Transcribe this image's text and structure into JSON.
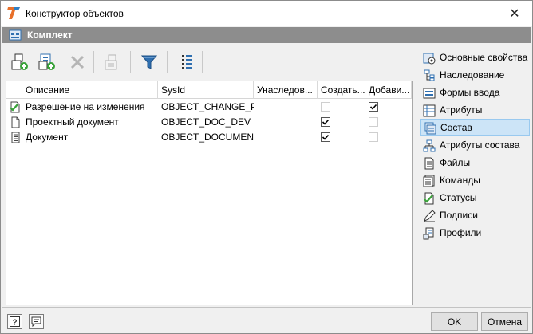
{
  "window": {
    "title": "Конструктор объектов",
    "app_icon": "app-logo-icon",
    "close_glyph": "✕"
  },
  "section": {
    "title": "Комплект",
    "icon": "kit-icon"
  },
  "toolbar": {
    "buttons": [
      {
        "name": "add-object-icon",
        "enabled": true
      },
      {
        "name": "add-object-from-set-icon",
        "enabled": true
      },
      {
        "name": "delete-icon",
        "enabled": false
      },
      {
        "name": "copy-object-icon",
        "enabled": false
      },
      {
        "name": "filter-icon",
        "enabled": true
      },
      {
        "name": "list-settings-icon",
        "enabled": true
      }
    ]
  },
  "grid": {
    "columns": [
      "Описание",
      "SysId",
      "Унаследов...",
      "Создать...",
      "Добави..."
    ],
    "rows": [
      {
        "icon": "document-check-icon",
        "description": "Разрешение на изменения",
        "sysid": "OBJECT_CHANGE_P...",
        "inherited": "",
        "create": false,
        "create_enabled": false,
        "add": true,
        "add_enabled": true
      },
      {
        "icon": "document-icon",
        "description": "Проектный документ",
        "sysid": "OBJECT_DOC_DEV",
        "inherited": "",
        "create": true,
        "create_enabled": true,
        "add": false,
        "add_enabled": false
      },
      {
        "icon": "document-lines-icon",
        "description": "Документ",
        "sysid": "OBJECT_DOCUMENT",
        "inherited": "",
        "create": true,
        "create_enabled": true,
        "add": false,
        "add_enabled": false
      }
    ]
  },
  "sidebar": {
    "items": [
      {
        "label": "Основные свойства",
        "icon": "properties-icon"
      },
      {
        "label": "Наследование",
        "icon": "inheritance-icon"
      },
      {
        "label": "Формы ввода",
        "icon": "input-form-icon"
      },
      {
        "label": "Атрибуты",
        "icon": "attributes-icon"
      },
      {
        "label": "Состав",
        "icon": "composition-icon",
        "active": true
      },
      {
        "label": "Атрибуты состава",
        "icon": "composition-attributes-icon"
      },
      {
        "label": "Файлы",
        "icon": "files-icon"
      },
      {
        "label": "Команды",
        "icon": "commands-icon"
      },
      {
        "label": "Статусы",
        "icon": "statuses-icon"
      },
      {
        "label": "Подписи",
        "icon": "signatures-icon"
      },
      {
        "label": "Профили",
        "icon": "profiles-icon"
      }
    ]
  },
  "footer": {
    "help_icon": "help-icon",
    "comment_icon": "comment-icon",
    "ok_label": "OK",
    "cancel_label": "Отмена"
  },
  "colors": {
    "header_bar": "#8d8d8d",
    "selection": "#cce4f7",
    "selection_border": "#99c9ef",
    "icon_blue": "#2f6fb0",
    "icon_green": "#3aa33a"
  }
}
